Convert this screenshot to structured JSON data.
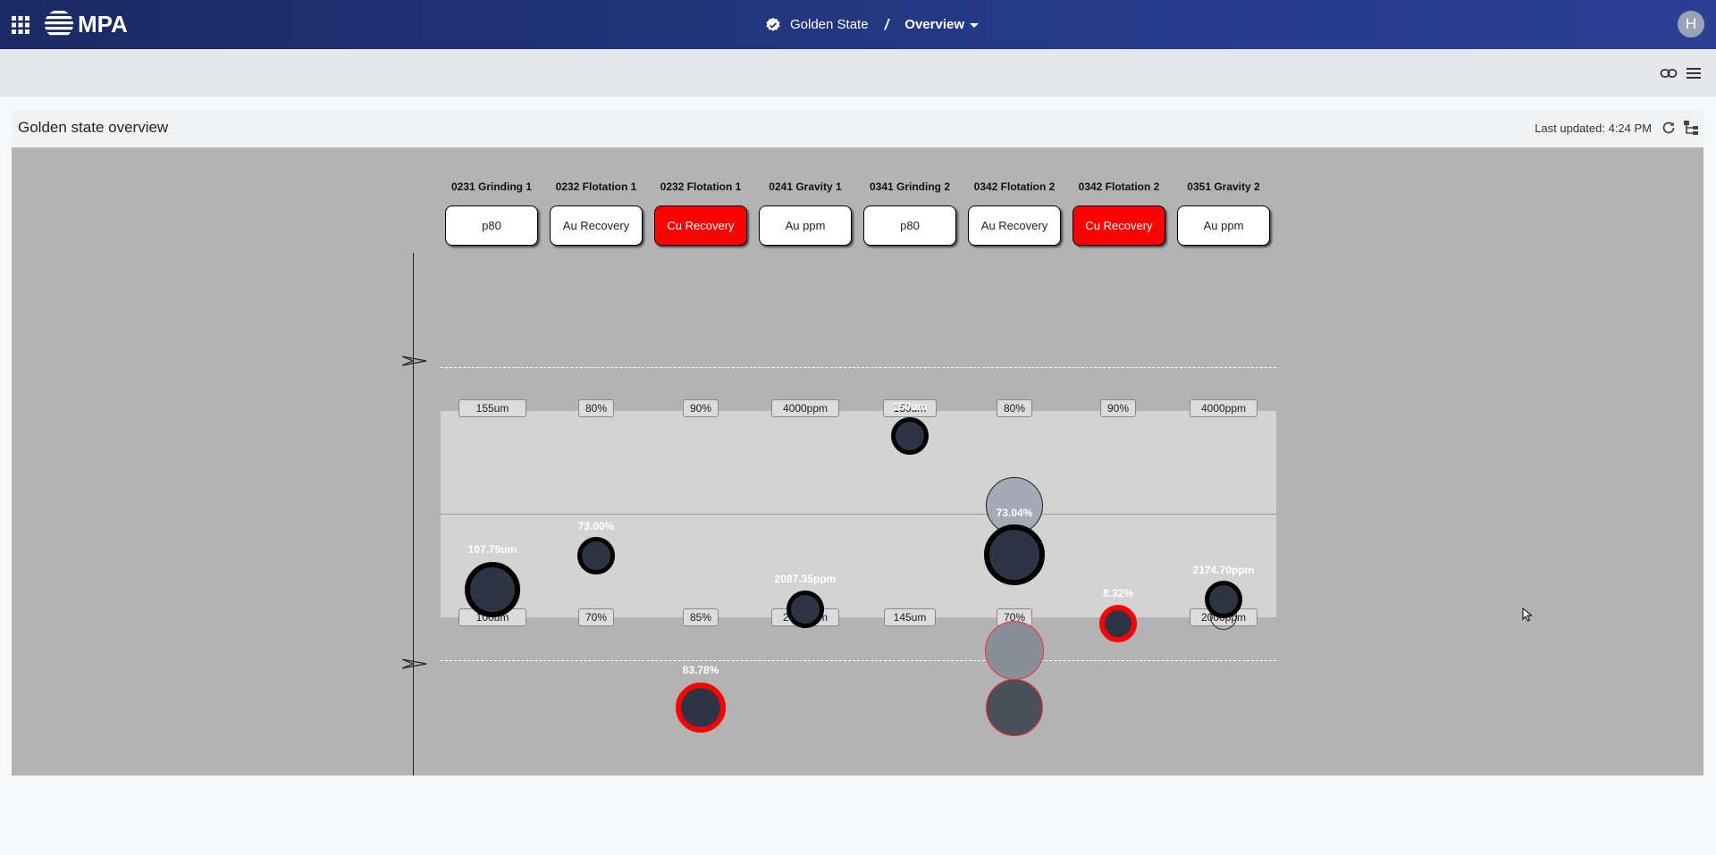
{
  "app": {
    "logo_text": "MPA"
  },
  "breadcrumb": {
    "site": "Golden State",
    "separator": "/",
    "view": "Overview"
  },
  "user": {
    "initial": "H"
  },
  "panel": {
    "title": "Golden state overview",
    "last_updated": "Last updated: 4:24 PM"
  },
  "columns": [
    {
      "title": "0231 Grinding 1",
      "kpi": "p80",
      "alarm": false,
      "upper": "155um",
      "lower": "100um",
      "value": "107.79um"
    },
    {
      "title": "0232 Flotation 1",
      "kpi": "Au Recovery",
      "alarm": false,
      "upper": "80%",
      "lower": "70%",
      "value": "73.00%"
    },
    {
      "title": "0232 Flotation 1",
      "kpi": "Cu Recovery",
      "alarm": true,
      "upper": "90%",
      "lower": "85%",
      "value": "83.78%"
    },
    {
      "title": "0241 Gravity 1",
      "kpi": "Au ppm",
      "alarm": false,
      "upper": "4000ppm",
      "lower": "2000ppm",
      "value": "2087.35ppm"
    },
    {
      "title": "0341 Grinding 2",
      "kpi": "p80",
      "alarm": false,
      "upper": "150um",
      "lower": "145um",
      "value": "150um"
    },
    {
      "title": "0342 Flotation 2",
      "kpi": "Au Recovery",
      "alarm": false,
      "upper": "80%",
      "lower": "70%",
      "value": "73.04%"
    },
    {
      "title": "0342 Flotation 2",
      "kpi": "Cu Recovery",
      "alarm": true,
      "upper": "90%",
      "lower": "",
      "value": "8.32%"
    },
    {
      "title": "0351 Gravity 2",
      "kpi": "Au ppm",
      "alarm": false,
      "upper": "4000ppm",
      "lower": "2000ppm",
      "value": "2174.70ppm"
    }
  ],
  "colors": {
    "header_start": "#1b2a63",
    "header_end": "#2c3f93",
    "alarm": "#ff0000",
    "canvas": "#b3b3b3",
    "band": "#d3d3d3",
    "bubble_fill": "#2e3443"
  },
  "icons": [
    "apps-grid-icon",
    "mpa-logo-icon",
    "verified-badge-icon",
    "chevron-down-icon",
    "link-icon",
    "menu-icon",
    "refresh-icon",
    "tree-view-icon"
  ]
}
